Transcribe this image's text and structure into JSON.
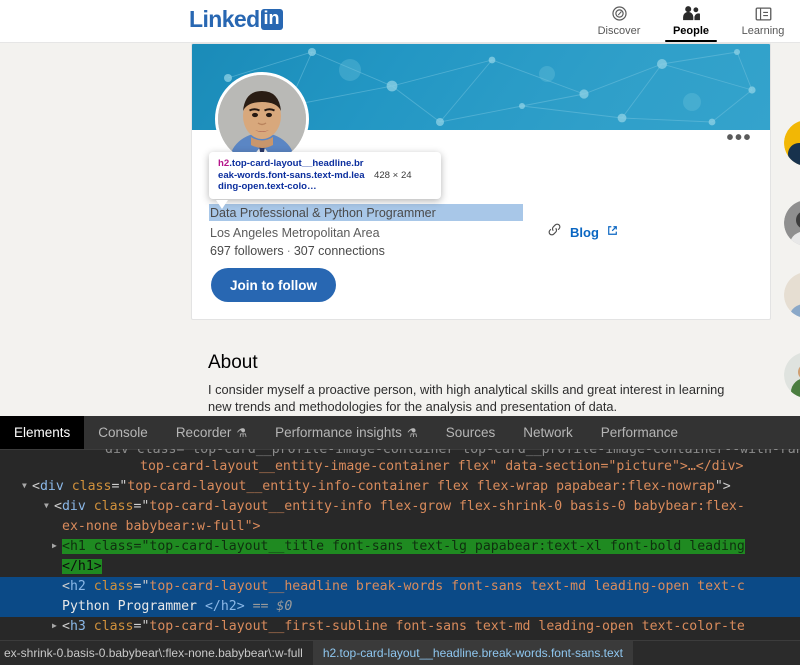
{
  "browser": {
    "nav": {
      "logo_word": "Linked",
      "logo_box": "in",
      "items": [
        {
          "label": "Discover",
          "icon": "compass-icon",
          "active": false
        },
        {
          "label": "People",
          "icon": "people-icon",
          "active": true
        },
        {
          "label": "Learning",
          "icon": "learning-icon",
          "active": false
        }
      ]
    },
    "profile": {
      "headline": "Data Professional & Python Programmer",
      "location": "Los Angeles Metropolitan Area",
      "followers": "697 followers",
      "separator": "·",
      "connections": "307 connections",
      "follow_button": "Join to follow",
      "blog_label": "Blog",
      "more_menu": "•••",
      "link_icon": "link-icon",
      "external_icon": "external-link-icon"
    },
    "inspector_tooltip": {
      "tag": "h2",
      "selector_rest": ".top-card-layout__headline.break-words.font-sans.text-md.leading-open.text-colo…",
      "dimensions": "428 × 24"
    },
    "about": {
      "title": "About",
      "body": "I consider myself a proactive person, with high analytical skills and great interest in learning new trends and methodologies for the analysis and presentation of data."
    }
  },
  "devtools": {
    "tabs": [
      {
        "label": "Elements",
        "active": true,
        "flask": false
      },
      {
        "label": "Console",
        "active": false,
        "flask": false
      },
      {
        "label": "Recorder",
        "active": false,
        "flask": true
      },
      {
        "label": "Performance insights",
        "active": false,
        "flask": true
      },
      {
        "label": "Sources",
        "active": false,
        "flask": false
      },
      {
        "label": "Network",
        "active": false,
        "flask": false
      },
      {
        "label": "Performance",
        "active": false,
        "flask": false
      }
    ],
    "flask_glyph": "⚗",
    "dom_lines": {
      "l0_clipped": "div class=\"top-card__profile-image-container top-card__profile-image-container--with-ran",
      "l1": "top-card-layout__entity-image-container flex\" data-section=\"picture\">…</div>",
      "l2_tag": "div",
      "l2_class": "top-card-layout__entity-info-container flex flex-wrap papabear:flex-nowrap",
      "l3_tag": "div",
      "l3_class_a": "top-card-layout__entity-info flex-grow flex-shrink-0 basis-0 babybear:flex-",
      "l3_class_b": "ex-none babybear:w-full\">",
      "l4_tag": "h1",
      "l4_class": "top-card-layout__title font-sans text-lg papabear:text-xl font-bold leading",
      "l4_close": "</h1>",
      "l5_tag": "h2",
      "l5_class": "top-card-layout__headline break-words font-sans text-md leading-open text-c",
      "l5_text": "Python Programmer",
      "l5_close": "</h2>",
      "l5_dollar": "== $0",
      "l6_tag": "h3",
      "l6_class": "top-card-layout__first-subline font-sans text-md leading-open text-color-te"
    },
    "breadcrumbs": [
      {
        "label": "ex-shrink-0.basis-0.babybear\\:flex-none.babybear\\:w-full",
        "selected": false
      },
      {
        "label": "h2.top-card-layout__headline.break-words.font-sans.text",
        "selected": true
      }
    ]
  }
}
